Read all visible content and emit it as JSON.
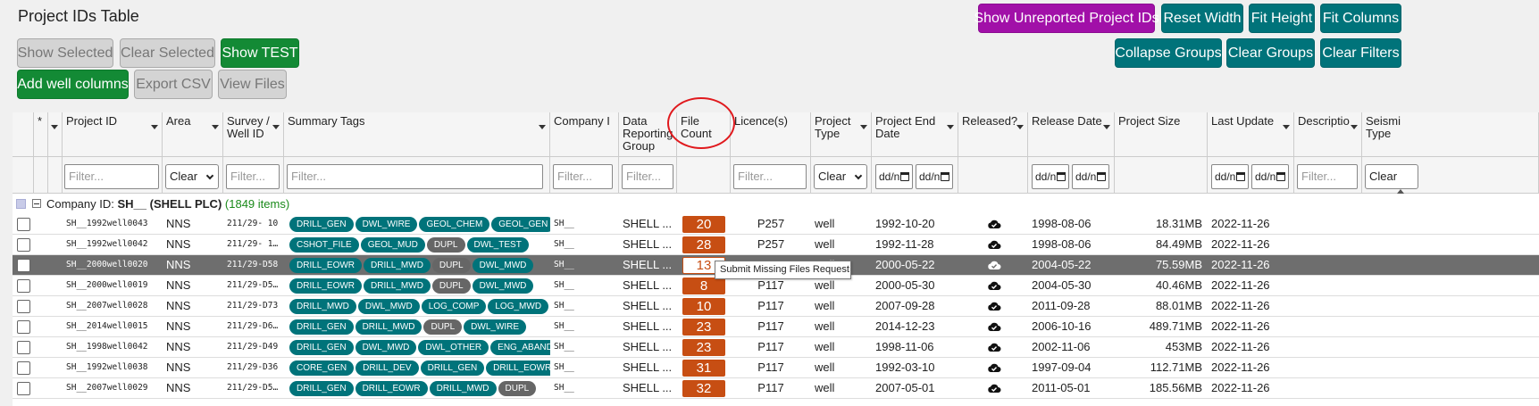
{
  "title": "Project IDs Table",
  "toolbar": {
    "show_selected": "Show Selected",
    "clear_selected": "Clear Selected",
    "show_test": "Show TEST",
    "add_well_columns": "Add well columns",
    "export_csv": "Export CSV",
    "view_files": "View Files",
    "show_unreported": "Show Unreported Project IDs",
    "reset_width": "Reset Width",
    "fit_height": "Fit Height",
    "fit_columns": "Fit Columns",
    "collapse_groups": "Collapse Groups",
    "clear_groups": "Clear Groups",
    "clear_filters": "Clear Filters"
  },
  "columns": {
    "star": "*",
    "project_id": "Project ID",
    "area": "Area",
    "survey_l1": "Survey /",
    "survey_l2": "Well ID",
    "summary_tags": "Summary Tags",
    "company": "Company I",
    "drg_l1": "Data",
    "drg_l2": "Reporting",
    "drg_l3": "Group",
    "fc_l1": "File",
    "fc_l2": "Count",
    "licence": "Licence(s)",
    "pt_l1": "Project",
    "pt_l2": "Type",
    "ped_l1": "Project End",
    "ped_l2": "Date",
    "released": "Released?",
    "release_date": "Release Date",
    "project_size": "Project Size",
    "last_update": "Last Update",
    "description": "Descriptio",
    "seis_l1": "Seismi",
    "seis_l2": "Type"
  },
  "filters": {
    "placeholder": "Filter...",
    "clear": "Clear",
    "date": "dd/n"
  },
  "group": {
    "label": "Company ID:",
    "value": "SH__ (SHELL PLC)",
    "count": "(1849 items)"
  },
  "tooltip": "Submit Missing Files Request",
  "rows": [
    {
      "pid": "SH__1992well0043",
      "area": "NNS",
      "survey": "211/29- 10",
      "tags": [
        "DRILL_GEN",
        "DWL_WIRE",
        "GEOL_CHEM",
        "GEOL_GEN"
      ],
      "company": "SH__",
      "drg": "SHELL ...",
      "files": "20",
      "licence": "P257",
      "ptype": "well",
      "end_date": "1992-10-20",
      "release_date": "1998-08-06",
      "size": "18.31MB",
      "updated": "2022-11-26"
    },
    {
      "pid": "SH__1992well0042",
      "area": "NNS",
      "survey": "211/29- 1…",
      "tags": [
        "CSHOT_FILE",
        "GEOL_MUD",
        "DUPL",
        "DWL_TEST"
      ],
      "company": "SH__",
      "drg": "SHELL ...",
      "files": "28",
      "licence": "P257",
      "ptype": "well",
      "end_date": "1992-11-28",
      "release_date": "1998-08-06",
      "size": "84.49MB",
      "updated": "2022-11-26"
    },
    {
      "pid": "SH__2000well0020",
      "area": "NNS",
      "survey": "211/29-D58",
      "tags": [
        "DRILL_EOWR",
        "DRILL_MWD",
        "DUPL",
        "DWL_MWD"
      ],
      "company": "SH__",
      "drg": "SHELL ...",
      "files": "13",
      "licence": "P117",
      "ptype": "well",
      "end_date": "2000-05-22",
      "release_date": "2004-05-22",
      "size": "75.59MB",
      "updated": "2022-11-26"
    },
    {
      "pid": "SH__2000well0019",
      "area": "NNS",
      "survey": "211/29-D5…",
      "tags": [
        "DRILL_EOWR",
        "DRILL_MWD",
        "DUPL",
        "DWL_MWD"
      ],
      "company": "SH__",
      "drg": "SHELL ...",
      "files": "8",
      "licence": "P117",
      "ptype": "well",
      "end_date": "2000-05-30",
      "release_date": "2004-05-30",
      "size": "40.46MB",
      "updated": "2022-11-26"
    },
    {
      "pid": "SH__2007well0028",
      "area": "NNS",
      "survey": "211/29-D73",
      "tags": [
        "DRILL_MWD",
        "DWL_MWD",
        "LOG_COMP",
        "LOG_MWD"
      ],
      "company": "SH__",
      "drg": "SHELL ...",
      "files": "10",
      "licence": "P117",
      "ptype": "well",
      "end_date": "2007-09-28",
      "release_date": "2011-09-28",
      "size": "88.01MB",
      "updated": "2022-11-26"
    },
    {
      "pid": "SH__2014well0015",
      "area": "NNS",
      "survey": "211/29-D6…",
      "tags": [
        "DRILL_GEN",
        "DRILL_MWD",
        "DUPL",
        "DWL_WIRE"
      ],
      "company": "SH__",
      "drg": "SHELL ...",
      "files": "23",
      "licence": "P117",
      "ptype": "well",
      "end_date": "2014-12-23",
      "release_date": "2006-10-16",
      "size": "489.71MB",
      "updated": "2022-11-26"
    },
    {
      "pid": "SH__1998well0042",
      "area": "NNS",
      "survey": "211/29-D49",
      "tags": [
        "DRILL_GEN",
        "DWL_MWD",
        "DWL_OTHER",
        "ENG_ABAND"
      ],
      "company": "SH__",
      "drg": "SHELL ...",
      "files": "23",
      "licence": "P117",
      "ptype": "well",
      "end_date": "1998-11-06",
      "release_date": "2002-11-06",
      "size": "453MB",
      "updated": "2022-11-26"
    },
    {
      "pid": "SH__1992well0038",
      "area": "NNS",
      "survey": "211/29-D36",
      "tags": [
        "CORE_GEN",
        "DRILL_DEV",
        "DRILL_GEN",
        "DRILL_EOWR"
      ],
      "company": "SH__",
      "drg": "SHELL ...",
      "files": "31",
      "licence": "P117",
      "ptype": "well",
      "end_date": "1992-03-10",
      "release_date": "1997-09-04",
      "size": "112.71MB",
      "updated": "2022-11-26"
    },
    {
      "pid": "SH__2007well0029",
      "area": "NNS",
      "survey": "211/29-D5…",
      "tags": [
        "DRILL_GEN",
        "DRILL_EOWR",
        "DRILL_MWD",
        "DUPL"
      ],
      "company": "SH__",
      "drg": "SHELL ...",
      "files": "32",
      "licence": "P117",
      "ptype": "well",
      "end_date": "2007-05-01",
      "release_date": "2011-05-01",
      "size": "185.56MB",
      "updated": "2022-11-26"
    }
  ]
}
